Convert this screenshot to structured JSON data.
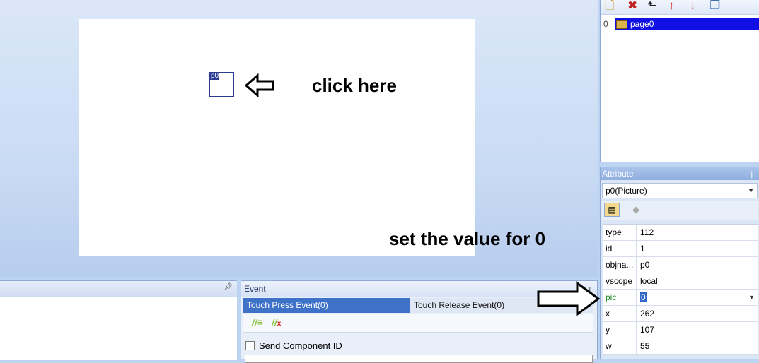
{
  "design": {
    "component_tag": "p0",
    "click_label": "click here",
    "set_label": "set the value for 0"
  },
  "tree": {
    "toolbar_icons": [
      "add-page-icon",
      "delete-page-icon",
      "insert-page-icon",
      "move-up-icon",
      "move-down-icon",
      "copy-page-icon"
    ],
    "rows": [
      {
        "index": "0",
        "name": "page0"
      }
    ]
  },
  "attribute": {
    "title": "Attribute",
    "selected_component": "p0(Picture)",
    "rows": [
      {
        "key": "type",
        "value": "112"
      },
      {
        "key": "id",
        "value": "1"
      },
      {
        "key": "objna...",
        "value": "p0"
      },
      {
        "key": "vscope",
        "value": "local"
      },
      {
        "key": "pic",
        "value": "0"
      },
      {
        "key": "x",
        "value": "262"
      },
      {
        "key": "y",
        "value": "107"
      },
      {
        "key": "w",
        "value": "55"
      }
    ]
  },
  "event": {
    "title": "Event",
    "tabs": [
      "Touch Press Event(0)",
      "Touch Release Event(0)"
    ],
    "send_component_id": "Send Component ID"
  }
}
